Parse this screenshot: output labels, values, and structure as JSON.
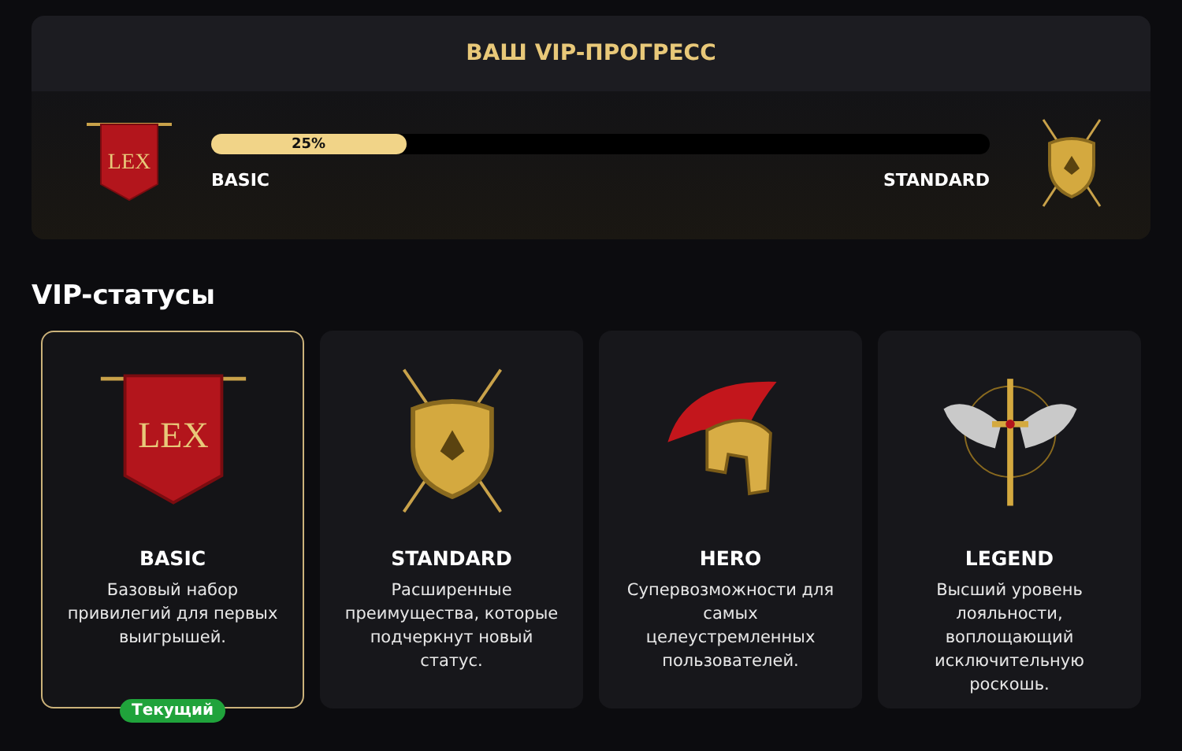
{
  "progress": {
    "title": "ВАШ VIP-ПРОГРЕСС",
    "level": 0.25,
    "reading": "25%",
    "from": {
      "label": "BASIC",
      "kind": "banner",
      "emblem_text": "LEX"
    },
    "to": {
      "label": "STANDARD",
      "kind": "shield"
    }
  },
  "section_title": "VIP-статусы",
  "statuses": [
    {
      "name": "BASIC",
      "kind": "banner",
      "emblem_text": "LEX",
      "description": "Базовый набор привилегий для первых выигрышей.",
      "selected": true,
      "badge": "Текущий"
    },
    {
      "name": "STANDARD",
      "kind": "shield",
      "description": "Расширенные преимущества, которые подчеркнут новый статус.",
      "selected": false
    },
    {
      "name": "HERO",
      "kind": "helmet",
      "description": "Супервозможности для самых целеустремленных пользователей.",
      "selected": false
    },
    {
      "name": "LEGEND",
      "kind": "sword",
      "description": "Высший уровень лояльности, воплощающий исключительную роскошь.",
      "selected": false
    }
  ]
}
